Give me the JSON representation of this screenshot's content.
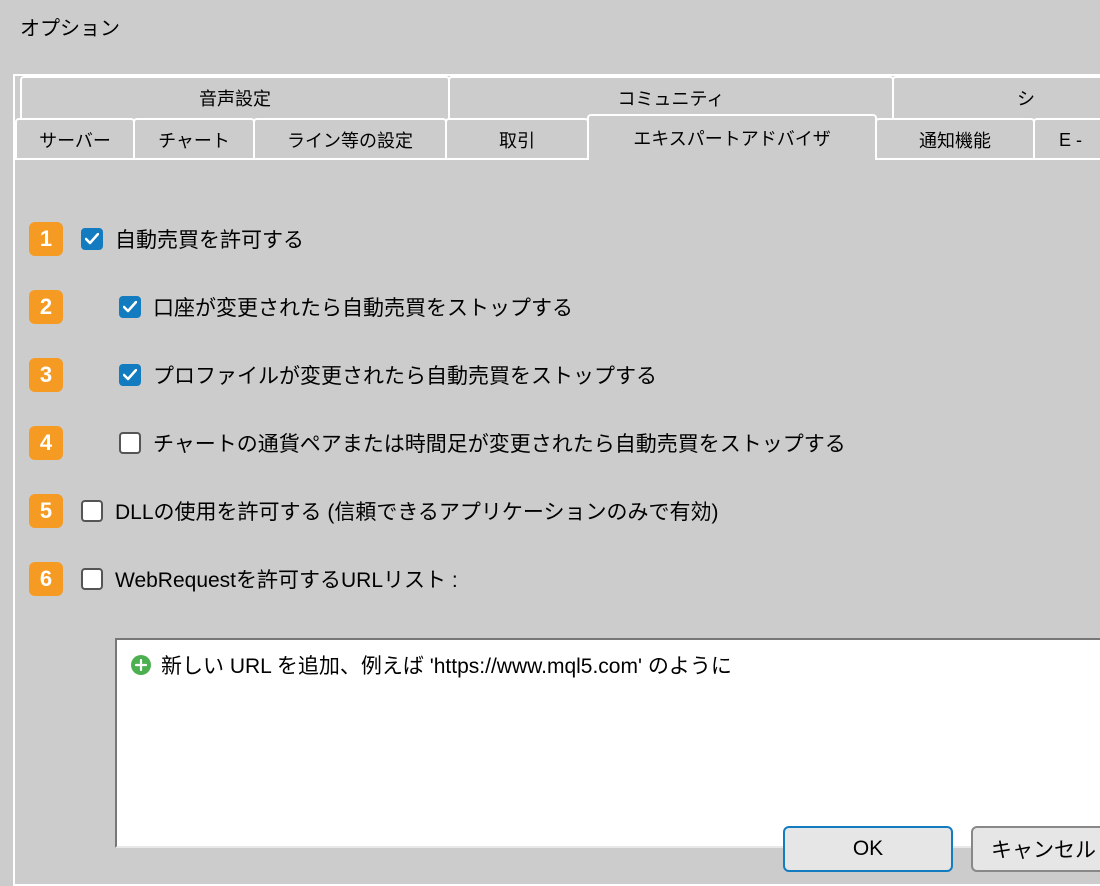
{
  "title": "オプション",
  "tabs_row_top": [
    {
      "id": "audio",
      "label": "音声設定"
    },
    {
      "id": "community",
      "label": "コミュニティ"
    },
    {
      "id": "sign",
      "label": "シ"
    }
  ],
  "tabs_row_bottom": [
    {
      "id": "server",
      "label": "サーバー"
    },
    {
      "id": "chart",
      "label": "チャート"
    },
    {
      "id": "line",
      "label": "ライン等の設定"
    },
    {
      "id": "trade",
      "label": "取引"
    },
    {
      "id": "ea",
      "label": "エキスパートアドバイザ",
      "active": true
    },
    {
      "id": "notify",
      "label": "通知機能"
    },
    {
      "id": "email",
      "label": "E -"
    }
  ],
  "options": {
    "allow_autotrade": {
      "num": "1",
      "label": "自動売買を許可する",
      "checked": true,
      "indent": 0
    },
    "stop_on_account_change": {
      "num": "2",
      "label": "口座が変更されたら自動売買をストップする",
      "checked": true,
      "indent": 1
    },
    "stop_on_profile_change": {
      "num": "3",
      "label": "プロファイルが変更されたら自動売買をストップする",
      "checked": true,
      "indent": 1
    },
    "stop_on_symbol_change": {
      "num": "4",
      "label": "チャートの通貨ペアまたは時間足が変更されたら自動売買をストップする",
      "checked": false,
      "indent": 1
    },
    "allow_dll": {
      "num": "5",
      "label": "DLLの使用を許可する (信頼できるアプリケーションのみで有効)",
      "checked": false,
      "indent": 0
    },
    "allow_webrequest": {
      "num": "6",
      "label": "WebRequestを許可するURLリスト :",
      "checked": false,
      "indent": 0
    }
  },
  "url_placeholder": "新しい URL を追加、例えば 'https://www.mql5.com' のように",
  "buttons": {
    "ok": "OK",
    "cancel": "キャンセル"
  },
  "colors": {
    "accent": "#137cc1",
    "badge": "#f59b23"
  }
}
